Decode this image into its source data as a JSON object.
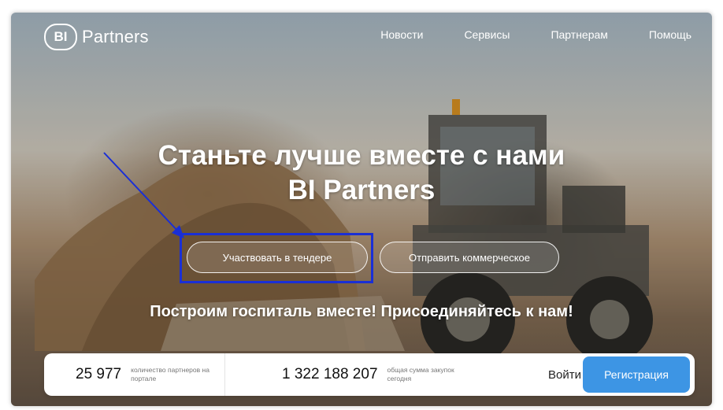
{
  "header": {
    "logo_mark": "BI",
    "logo_text": "Partners",
    "nav": [
      "Новости",
      "Сервисы",
      "Партнерам",
      "Помощь"
    ]
  },
  "hero": {
    "title_line1": "Станьте лучше вместе с нами",
    "title_line2": "BI Partners",
    "cta_primary": "Участвовать в тендере",
    "cta_secondary": "Отправить коммерческое",
    "subtitle": "Построим госпиталь вместе! Присоединяйтесь к нам!"
  },
  "stats": {
    "partners_value": "25 977",
    "partners_caption": "количество партнеров на портале",
    "purchases_value": "1 322 188 207",
    "purchases_caption": "общая сумма закупок сегодня"
  },
  "auth": {
    "login": "Войти",
    "register": "Регистрация"
  },
  "colors": {
    "annotation": "#1a2fd6",
    "register_button": "#3d95e4"
  }
}
